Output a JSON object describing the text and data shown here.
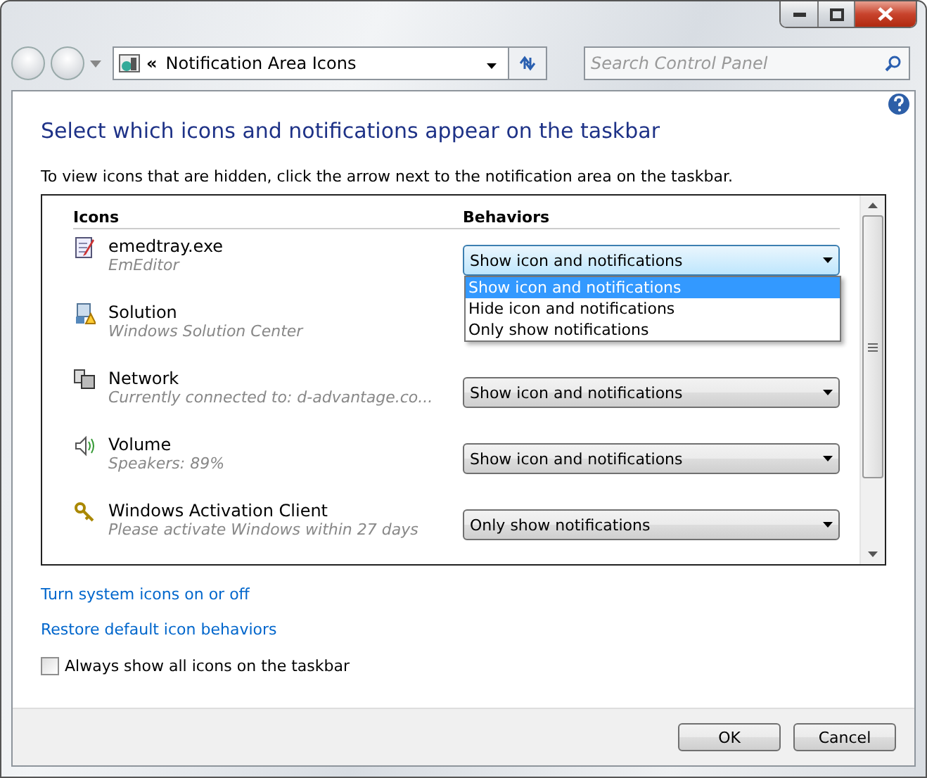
{
  "address_bar": {
    "chevron": "«",
    "location": "Notification Area Icons"
  },
  "search": {
    "placeholder": "Search Control Panel"
  },
  "heading": "Select which icons and notifications appear on the taskbar",
  "instructions": "To view icons that are hidden, click the arrow next to the notification area on the taskbar.",
  "table": {
    "columns": [
      "Icons",
      "Behaviors"
    ],
    "rows": [
      {
        "kind": "editor",
        "name": "emedtray.exe",
        "detail": "EmEditor",
        "behavior": "Show icon and notifications",
        "expanded": true,
        "options": [
          {
            "label": "Show icon and notifications",
            "selected": true
          },
          {
            "label": "Hide icon and notifications",
            "selected": false
          },
          {
            "label": "Only show notifications",
            "selected": false
          }
        ]
      },
      {
        "kind": "solution",
        "name": "Solution",
        "detail": "Windows Solution Center"
      },
      {
        "kind": "network",
        "name": "Network",
        "detail": "Currently connected to: d-advantage.co...",
        "behavior": "Show icon and notifications",
        "expanded": false
      },
      {
        "kind": "volume",
        "name": "Volume",
        "detail": "Speakers: 89%",
        "behavior": "Show icon and notifications",
        "expanded": false
      },
      {
        "kind": "activation",
        "name": "Windows Activation Client",
        "detail": "Please activate Windows within 27 days",
        "behavior": "Only show notifications",
        "expanded": false
      }
    ]
  },
  "links": [
    "Turn system icons on or off",
    "Restore default icon behaviors"
  ],
  "always_show": {
    "label": "Always show all icons on the taskbar",
    "checked": false
  },
  "buttons": [
    "OK",
    "Cancel"
  ]
}
